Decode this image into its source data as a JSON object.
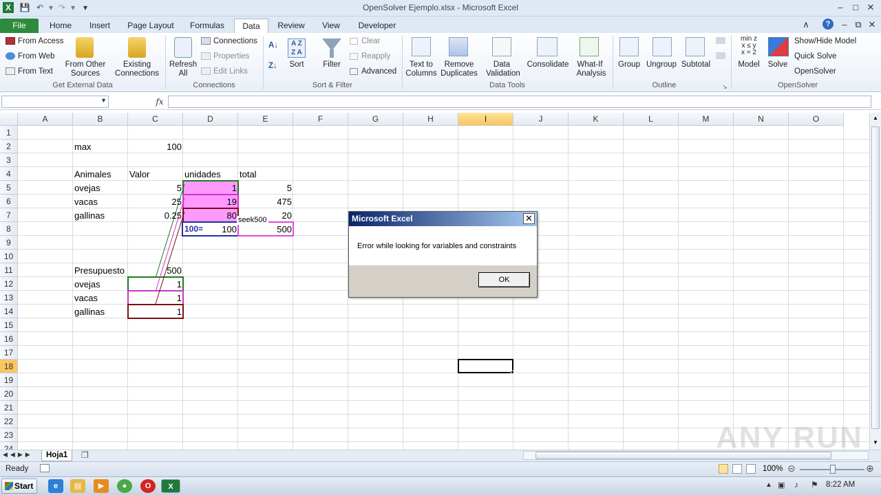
{
  "window": {
    "title": "OpenSolver Ejemplo.xlsx  -  Microsoft Excel",
    "app_icon": "excel-icon",
    "controls": [
      "minimize-icon",
      "maximize-icon",
      "close-icon"
    ]
  },
  "ribbon_tabs": [
    "File",
    "Home",
    "Insert",
    "Page Layout",
    "Formulas",
    "Data",
    "Review",
    "View",
    "Developer"
  ],
  "active_tab": "Data",
  "ribbon": {
    "get_external": {
      "from_access": "From Access",
      "from_web": "From Web",
      "from_text": "From Text",
      "from_other_1": "From Other",
      "from_other_2": "Sources",
      "existing_1": "Existing",
      "existing_2": "Connections",
      "label": "Get External Data"
    },
    "connections": {
      "refresh_1": "Refresh",
      "refresh_2": "All",
      "connections": "Connections",
      "properties": "Properties",
      "edit_links": "Edit Links",
      "label": "Connections"
    },
    "sort_filter": {
      "sort": "Sort",
      "filter": "Filter",
      "clear": "Clear",
      "reapply": "Reapply",
      "advanced": "Advanced",
      "label": "Sort & Filter"
    },
    "data_tools": {
      "text_to_columns_1": "Text to",
      "text_to_columns_2": "Columns",
      "remove_dup_1": "Remove",
      "remove_dup_2": "Duplicates",
      "validation_1": "Data",
      "validation_2": "Validation",
      "consolidate": "Consolidate",
      "whatif_1": "What-If",
      "whatif_2": "Analysis",
      "label": "Data Tools"
    },
    "outline": {
      "group": "Group",
      "ungroup": "Ungroup",
      "subtotal": "Subtotal",
      "label": "Outline"
    },
    "opensolver": {
      "model_glyph_1": "min z",
      "model_glyph_2": "x ≤ y",
      "model_glyph_3": "x = 2",
      "model": "Model",
      "solve": "Solve",
      "show_hide": "Show/Hide Model",
      "quick_solve": "Quick Solve",
      "opensolver": "OpenSolver",
      "label": "OpenSolver"
    }
  },
  "formula_bar": {
    "name_box": "",
    "fx": "fx",
    "formula": ""
  },
  "columns": [
    "A",
    "B",
    "C",
    "D",
    "E",
    "F",
    "G",
    "H",
    "I",
    "J",
    "K",
    "L",
    "M",
    "N",
    "O"
  ],
  "selected_column": "I",
  "rows": [
    "1",
    "2",
    "3",
    "4",
    "5",
    "6",
    "7",
    "8",
    "9",
    "10",
    "11",
    "12",
    "13",
    "14",
    "15",
    "16",
    "17",
    "18",
    "19",
    "20",
    "21",
    "22",
    "23",
    "24"
  ],
  "selected_row": "18",
  "cells": {
    "B2": "max",
    "C2": "100",
    "B4": "Animales",
    "C4": "Valor",
    "D4": "unidades",
    "E4": "total",
    "B5": "ovejas",
    "C5": "5",
    "D5": "1",
    "E5": "5",
    "B6": "vacas",
    "C6": "25",
    "D6": "19",
    "E6": "475",
    "B7": "gallinas",
    "C7": "0.25",
    "D7": "80",
    "E7": "20",
    "D8_label": "100=",
    "D8": "100",
    "E8": "500",
    "seek_label": "seek500",
    "B11": "Presupuesto",
    "C11": "500",
    "B12": "ovejas",
    "C12": "1",
    "B13": "vacas",
    "C13": "1",
    "B14": "gallinas",
    "C14": "1"
  },
  "sheet_tabs": [
    "Hoja1"
  ],
  "status": {
    "ready": "Ready",
    "zoom": "100%"
  },
  "taskbar": {
    "start": "Start",
    "clock": "8:22 AM"
  },
  "dialog": {
    "title": "Microsoft Excel",
    "message": "Error while looking for variables and constraints",
    "ok": "OK"
  },
  "watermark": "ANY RUN",
  "colors": {
    "file_tab": "#2e8b3e",
    "pink_fill": "#ff99ff",
    "green_border": "#1f7a1f",
    "magenta_border": "#cc33cc",
    "maroon_border": "#7a0f0f",
    "blue_border": "#1f2fa8",
    "selection_header": "#f9c660"
  }
}
